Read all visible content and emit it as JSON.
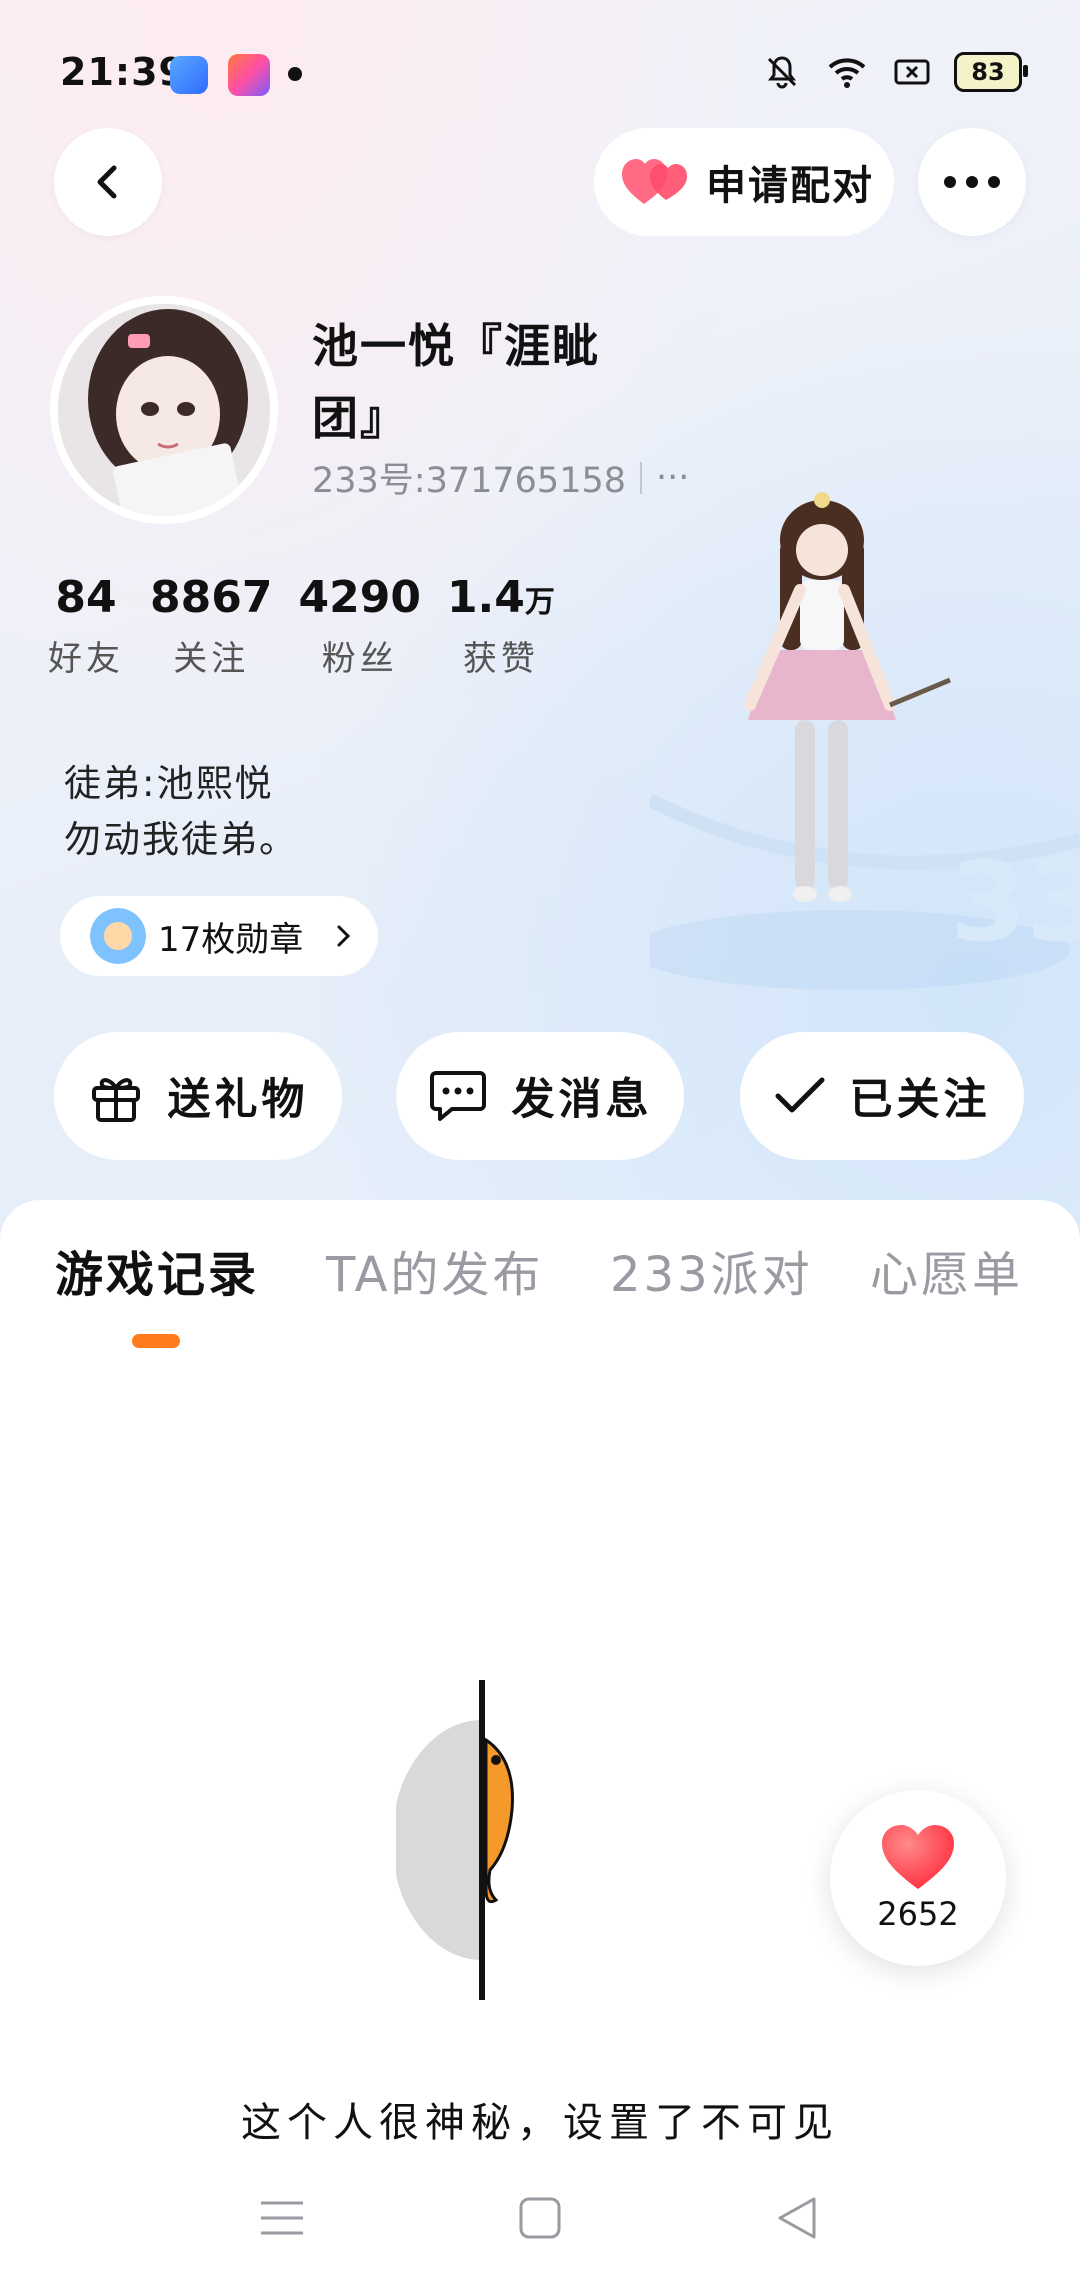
{
  "status_bar": {
    "time": "21:39",
    "battery": "83",
    "icons": [
      "app-icon-blue",
      "app-icon-gradient",
      "notification-dot",
      "bell-mute-icon",
      "wifi-icon",
      "screen-record-icon",
      "battery-icon"
    ]
  },
  "header": {
    "pair_label": "申请配对"
  },
  "profile": {
    "name_line1": "池一悦『涯眦",
    "name_line2": "团』",
    "uid": "233号:371765158",
    "uid_more": "···",
    "stats": [
      {
        "value": "84",
        "unit": "",
        "label": "好友"
      },
      {
        "value": "8867",
        "unit": "",
        "label": "关注"
      },
      {
        "value": "4290",
        "unit": "",
        "label": "粉丝"
      },
      {
        "value": "1.4",
        "unit": "万",
        "label": "获赞"
      }
    ],
    "bio_line1": "徒弟:池熙悦",
    "bio_line2": "勿动我徒弟。",
    "medal_label": "17枚勋章"
  },
  "actions": {
    "gift_label": "送礼物",
    "message_label": "发消息",
    "follow_label": "已关注"
  },
  "tabs": [
    {
      "label": "游戏记录",
      "active": true
    },
    {
      "label": "TA的发布",
      "active": false
    },
    {
      "label": "233派对",
      "active": false
    },
    {
      "label": "心愿单",
      "active": false
    }
  ],
  "empty_state": {
    "text": "这个人很神秘，设置了不可见"
  },
  "like_fab": {
    "count": "2652"
  },
  "colors": {
    "accent": "#ff7a1a",
    "heart": "#ff4d5e"
  }
}
